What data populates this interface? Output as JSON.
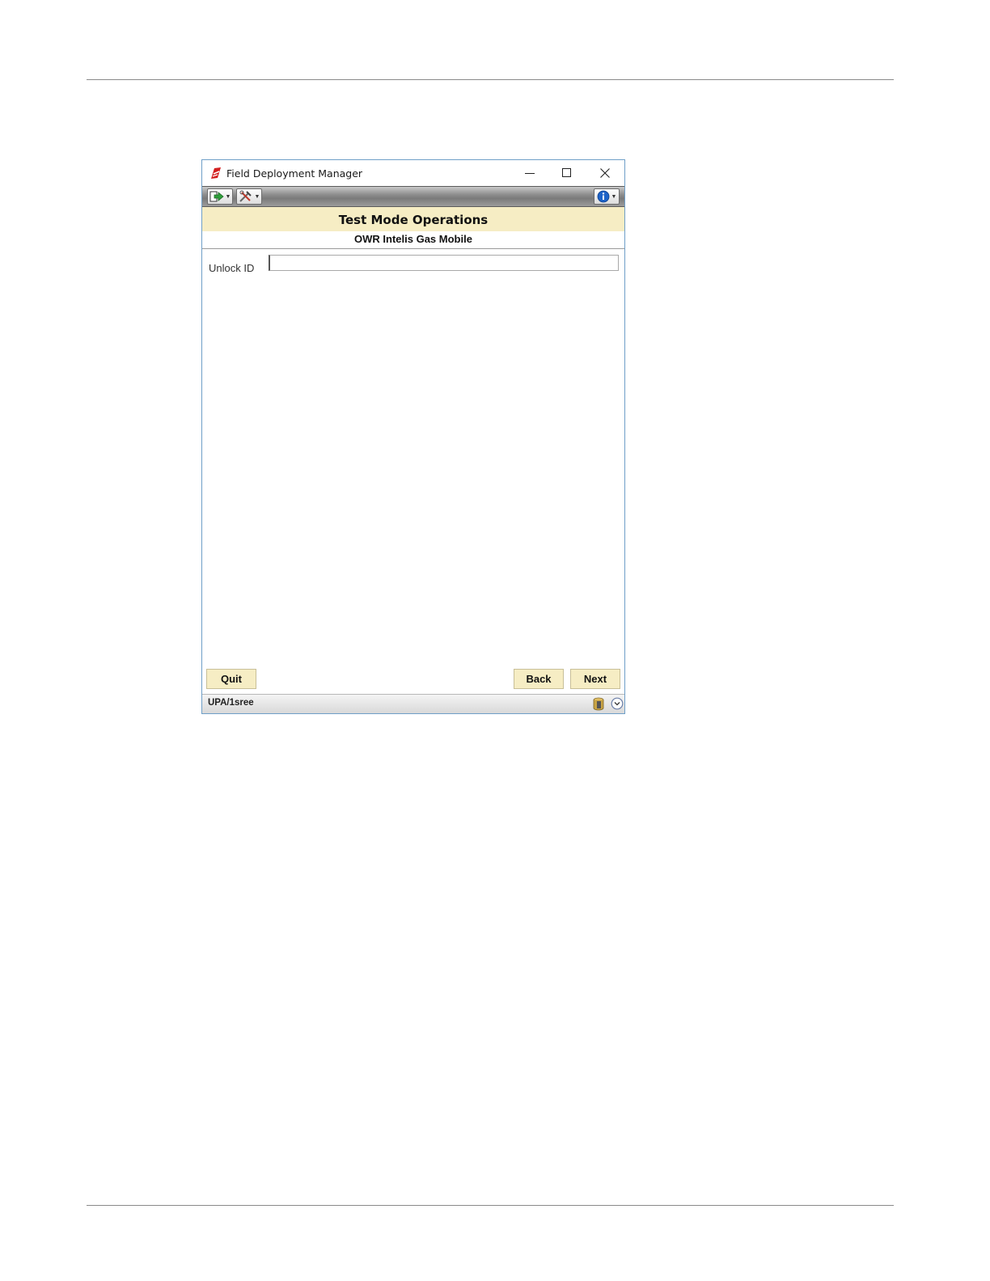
{
  "window": {
    "title": "Field Deployment Manager"
  },
  "toolbar": {
    "exit_icon": "exit-arrow-icon",
    "tools_icon": "tools-icon",
    "info_icon": "info-icon"
  },
  "header": {
    "title": "Test Mode Operations",
    "subtitle": "OWR Intelis Gas Mobile"
  },
  "form": {
    "unlock_id_label": "Unlock  ID",
    "unlock_id_value": "",
    "unlock_id_placeholder": ""
  },
  "buttons": {
    "quit": "Quit",
    "back": "Back",
    "next": "Next"
  },
  "status": {
    "text": "UPA/1sree"
  },
  "colors": {
    "header_band": "#f6edc4",
    "button_bg": "#f6edc4",
    "window_border": "#6f9fc8"
  }
}
